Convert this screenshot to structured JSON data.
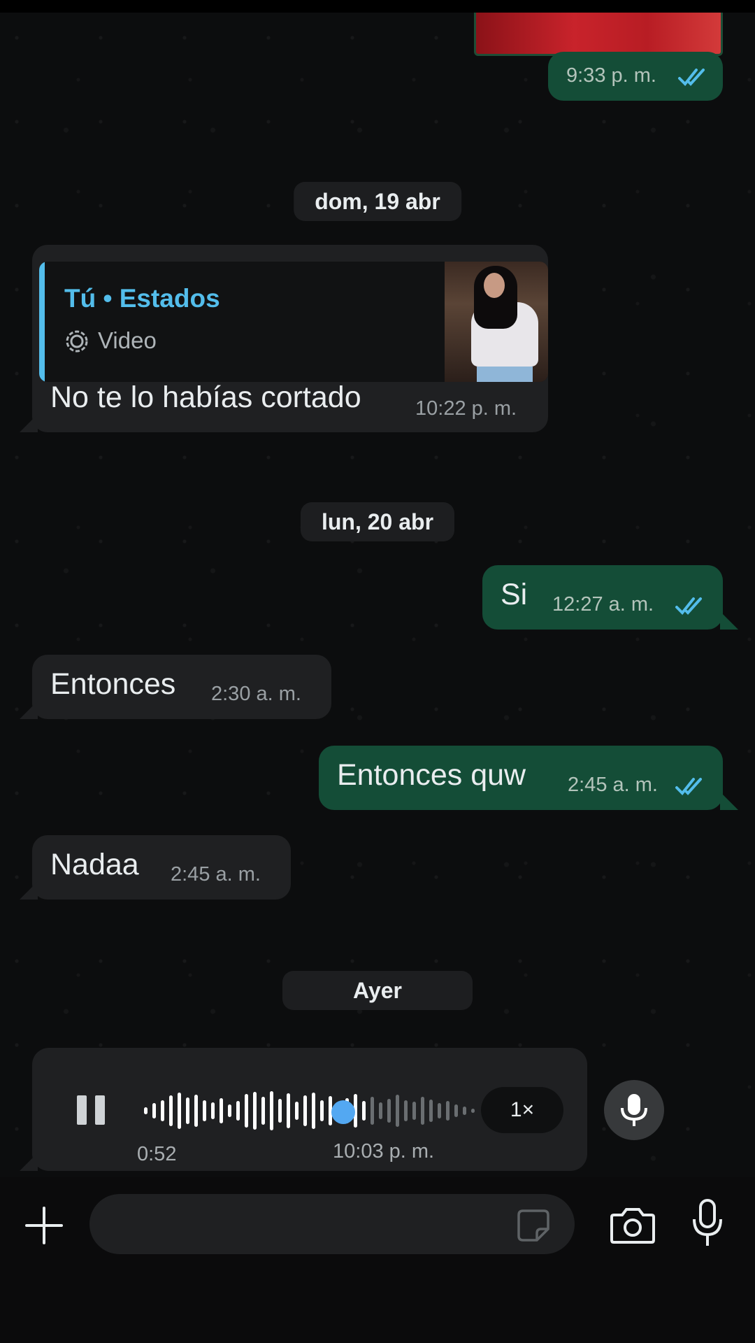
{
  "colors": {
    "outgoing_bubble": "#144d37",
    "incoming_bubble": "#1f2022",
    "accent_blue": "#53bdeb",
    "read_ticks": "#53bdeb"
  },
  "messages": [
    {
      "id": "m0",
      "direction": "out",
      "time": "9:33 p. m.",
      "status": "read"
    },
    {
      "id": "m1",
      "direction": "in",
      "quote": {
        "author": "Tú • Estados",
        "type": "Video",
        "icon": "status-ring-icon"
      },
      "text": "No te lo habías cortado",
      "time": "10:22 p. m."
    },
    {
      "id": "m2",
      "direction": "out",
      "text": "Si",
      "time": "12:27 a. m.",
      "status": "read"
    },
    {
      "id": "m3",
      "direction": "in",
      "text": "Entonces",
      "time": "2:30 a. m."
    },
    {
      "id": "m4",
      "direction": "out",
      "text": "Entonces quw",
      "time": "2:45 a. m.",
      "status": "read"
    },
    {
      "id": "m5",
      "direction": "in",
      "text": "Nadaa",
      "time": "2:45 a. m."
    }
  ],
  "dates": {
    "d1": "dom, 19 abr",
    "d2": "lun, 20 abr",
    "d3": "Ayer"
  },
  "voice_note": {
    "duration": "0:52",
    "time": "10:03 p. m.",
    "playback_speed": "1×",
    "progress": 0.68,
    "state": "playing"
  },
  "composer": {
    "placeholder": "",
    "value": ""
  }
}
